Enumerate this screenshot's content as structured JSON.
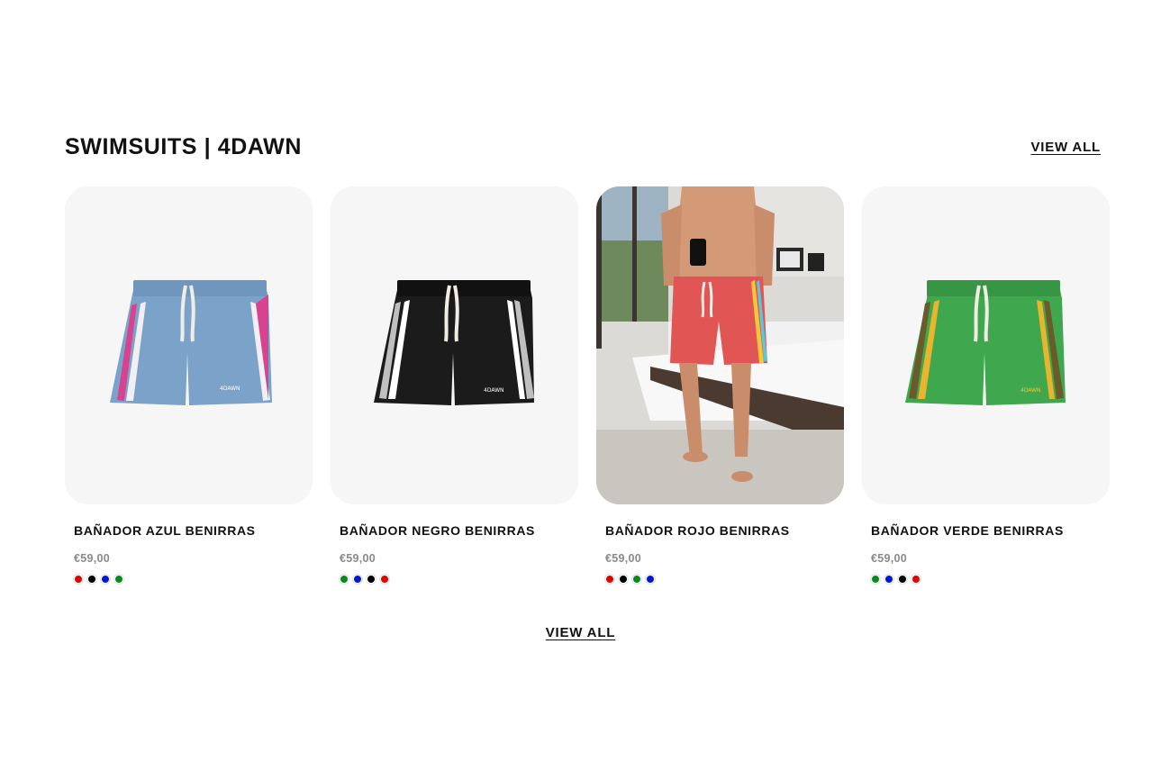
{
  "section": {
    "title": "SWIMSUITS | 4DAWN",
    "view_all_top": "VIEW ALL",
    "view_all_bottom": "VIEW ALL"
  },
  "products": [
    {
      "name": "BAÑADOR AZUL BENIRRAS",
      "price": "€59,00",
      "image": "blue-swim-shorts-pink-stripe",
      "short_color": "#7ba3c9",
      "stripe_colors": [
        "#d9428f",
        "#f2eff2"
      ],
      "swatches": [
        "#e00000",
        "#000000",
        "#0015d6",
        "#0a8a1e"
      ]
    },
    {
      "name": "BAÑADOR NEGRO BENIRRAS",
      "price": "€59,00",
      "image": "black-swim-shorts-grey-stripe",
      "short_color": "#1b1b1b",
      "stripe_colors": [
        "#bfbfbf",
        "#ffffff"
      ],
      "swatches": [
        "#0a8a1e",
        "#0015d6",
        "#000000",
        "#e00000"
      ]
    },
    {
      "name": "BAÑADOR ROJO BENIRRAS",
      "price": "€59,00",
      "image": "man-wearing-red-swim-shorts-bedroom-selfie",
      "short_color": "#e25555",
      "stripe_colors": [
        "#f2c73a",
        "#5fc6d9"
      ],
      "swatches": [
        "#e00000",
        "#000000",
        "#0a8a1e",
        "#0015d6"
      ]
    },
    {
      "name": "BAÑADOR VERDE BENIRRAS",
      "price": "€59,00",
      "image": "green-swim-shorts-yellow-stripe",
      "short_color": "#3fa84f",
      "stripe_colors": [
        "#e8b52c",
        "#6b5a2a"
      ],
      "swatches": [
        "#0a8a1e",
        "#0015d6",
        "#000000",
        "#e00000"
      ]
    }
  ]
}
